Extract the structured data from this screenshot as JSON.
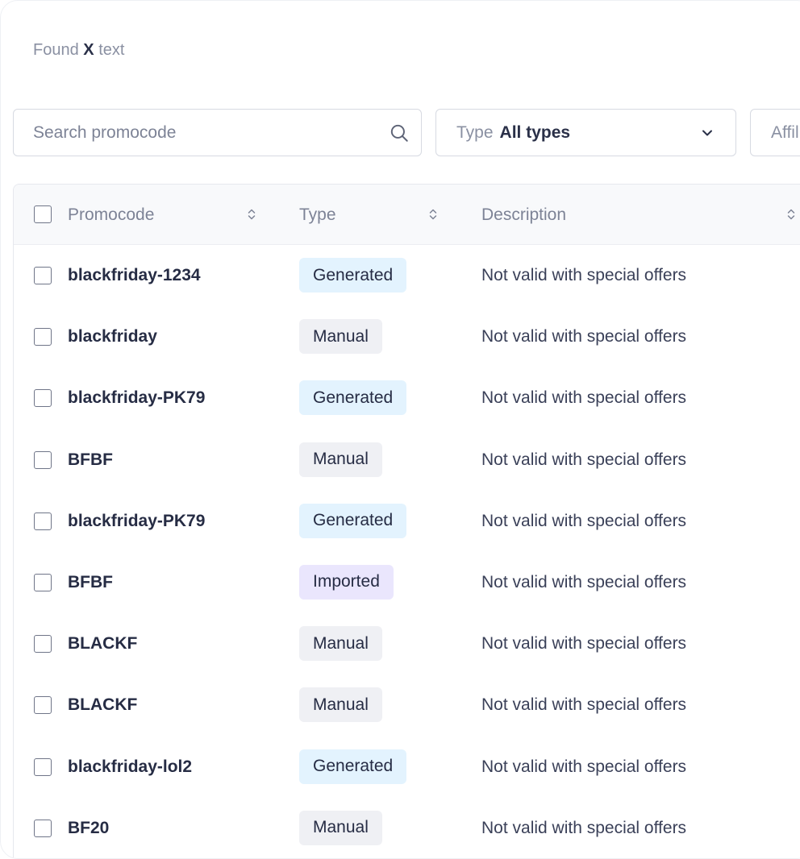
{
  "found": {
    "prefix": "Found",
    "strong": "X",
    "suffix": "text"
  },
  "search": {
    "placeholder": "Search promocode",
    "value": ""
  },
  "filters": {
    "type": {
      "label": "Type",
      "value": "All types"
    },
    "affiliate": {
      "label": "Affil"
    }
  },
  "table": {
    "columns": {
      "promocode": "Promocode",
      "type": "Type",
      "description": "Description"
    },
    "rows": [
      {
        "code": "blackfriday-1234",
        "type": "Generated",
        "kind": "generated",
        "description": "Not valid with special offers"
      },
      {
        "code": "blackfriday",
        "type": "Manual",
        "kind": "manual",
        "description": "Not valid with special offers"
      },
      {
        "code": "blackfriday-PK79",
        "type": "Generated",
        "kind": "generated",
        "description": "Not valid with special offers"
      },
      {
        "code": "BFBF",
        "type": "Manual",
        "kind": "manual",
        "description": "Not valid with special offers"
      },
      {
        "code": "blackfriday-PK79",
        "type": "Generated",
        "kind": "generated",
        "description": "Not valid with special offers"
      },
      {
        "code": "BFBF",
        "type": "Imported",
        "kind": "imported",
        "description": "Not valid with special offers"
      },
      {
        "code": "BLACKF",
        "type": "Manual",
        "kind": "manual",
        "description": "Not valid with special offers"
      },
      {
        "code": "BLACKF",
        "type": "Manual",
        "kind": "manual",
        "description": "Not valid with special offers"
      },
      {
        "code": "blackfriday-lol2",
        "type": "Generated",
        "kind": "generated",
        "description": "Not valid with special offers"
      },
      {
        "code": "BF20",
        "type": "Manual",
        "kind": "manual",
        "description": "Not valid with special offers"
      }
    ]
  },
  "colors": {
    "generated_badge": "#e3f3fe",
    "manual_badge": "#eff0f4",
    "imported_badge": "#eae6fd",
    "text_primary": "#262c44",
    "text_muted": "#7d8396"
  },
  "icons": {
    "search": "search-icon",
    "chevron": "chevron-down-icon",
    "sort": "sort-icon"
  }
}
